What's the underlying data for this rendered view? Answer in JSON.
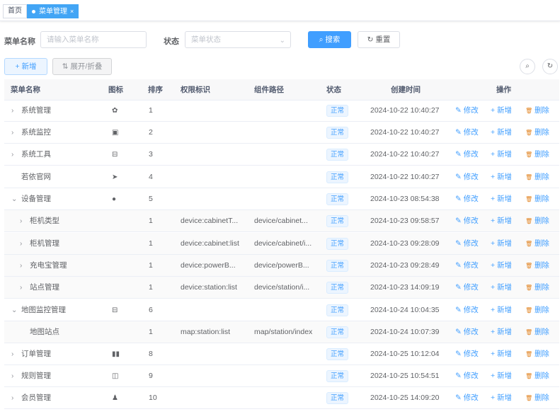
{
  "tags": {
    "home": "首页",
    "active": "菜单管理",
    "close": "×"
  },
  "search": {
    "name_label": "菜单名称",
    "name_placeholder": "请输入菜单名称",
    "status_label": "状态",
    "status_placeholder": "菜单状态",
    "search_btn": "搜索",
    "reset_btn": "重置",
    "search_icon": "⌕",
    "reset_icon": "↻",
    "chevron": "⌄"
  },
  "toolbar": {
    "add_btn": "新增",
    "add_icon": "+",
    "expand_btn": "展开/折叠",
    "expand_icon": "⇅",
    "search_icon": "⌕",
    "refresh_icon": "↻"
  },
  "columns": {
    "name": "菜单名称",
    "icon": "图标",
    "order": "排序",
    "perm": "权限标识",
    "comp": "组件路径",
    "status": "状态",
    "time": "创建时间",
    "ops": "操作"
  },
  "actions": {
    "edit": "修改",
    "add": "新增",
    "del": "删除",
    "edit_icon": "✎",
    "add_icon": "+",
    "del_icon": "🗑"
  },
  "rows": [
    {
      "name": "系统管理",
      "icon": "✿",
      "icon_name": "system-icon",
      "order": "1",
      "perm": "",
      "comp": "",
      "status": "正常",
      "time": "2024-10-22 10:40:27",
      "arrow": "›",
      "level": 0
    },
    {
      "name": "系统监控",
      "icon": "▣",
      "icon_name": "monitor-icon",
      "order": "2",
      "perm": "",
      "comp": "",
      "status": "正常",
      "time": "2024-10-22 10:40:27",
      "arrow": "›",
      "level": 0
    },
    {
      "name": "系统工具",
      "icon": "⊟",
      "icon_name": "tool-icon",
      "order": "3",
      "perm": "",
      "comp": "",
      "status": "正常",
      "time": "2024-10-22 10:40:27",
      "arrow": "›",
      "level": 0
    },
    {
      "name": "若依官网",
      "icon": "➤",
      "icon_name": "guide-icon",
      "order": "4",
      "perm": "",
      "comp": "",
      "status": "正常",
      "time": "2024-10-22 10:40:27",
      "arrow": "",
      "level": 0
    },
    {
      "name": "设备管理",
      "icon": "●",
      "icon_name": "github-icon",
      "order": "5",
      "perm": "",
      "comp": "",
      "status": "正常",
      "time": "2024-10-23 08:54:38",
      "arrow": "⌄",
      "level": 0
    },
    {
      "name": "柜机类型",
      "icon": "",
      "icon_name": "",
      "order": "1",
      "perm": "device:cabinetT...",
      "comp": "device/cabinet...",
      "status": "正常",
      "time": "2024-10-23 09:58:57",
      "arrow": "›",
      "level": 1
    },
    {
      "name": "柜机管理",
      "icon": "",
      "icon_name": "",
      "order": "1",
      "perm": "device:cabinet:list",
      "comp": "device/cabinet/i...",
      "status": "正常",
      "time": "2024-10-23 09:28:09",
      "arrow": "›",
      "level": 1
    },
    {
      "name": "充电宝管理",
      "icon": "",
      "icon_name": "",
      "order": "1",
      "perm": "device:powerB...",
      "comp": "device/powerB...",
      "status": "正常",
      "time": "2024-10-23 09:28:49",
      "arrow": "›",
      "level": 1
    },
    {
      "name": "站点管理",
      "icon": "",
      "icon_name": "",
      "order": "1",
      "perm": "device:station:list",
      "comp": "device/station/i...",
      "status": "正常",
      "time": "2024-10-23 14:09:19",
      "arrow": "›",
      "level": 1
    },
    {
      "name": "地图监控管理",
      "icon": "⊟",
      "icon_name": "tool-icon",
      "order": "6",
      "perm": "",
      "comp": "",
      "status": "正常",
      "time": "2024-10-24 10:04:35",
      "arrow": "⌄",
      "level": 0
    },
    {
      "name": "地图站点",
      "icon": "",
      "icon_name": "",
      "order": "1",
      "perm": "map:station:list",
      "comp": "map/station/index",
      "status": "正常",
      "time": "2024-10-24 10:07:39",
      "arrow": "",
      "level": 1
    },
    {
      "name": "订单管理",
      "icon": "▮▮",
      "icon_name": "chart-icon",
      "order": "8",
      "perm": "",
      "comp": "",
      "status": "正常",
      "time": "2024-10-25 10:12:04",
      "arrow": "›",
      "level": 0
    },
    {
      "name": "规则管理",
      "icon": "◫",
      "icon_name": "table-icon",
      "order": "9",
      "perm": "",
      "comp": "",
      "status": "正常",
      "time": "2024-10-25 10:54:51",
      "arrow": "›",
      "level": 0
    },
    {
      "name": "会员管理",
      "icon": "♟",
      "icon_name": "peoples-icon",
      "order": "10",
      "perm": "",
      "comp": "",
      "status": "正常",
      "time": "2024-10-25 14:09:20",
      "arrow": "›",
      "level": 0
    }
  ]
}
